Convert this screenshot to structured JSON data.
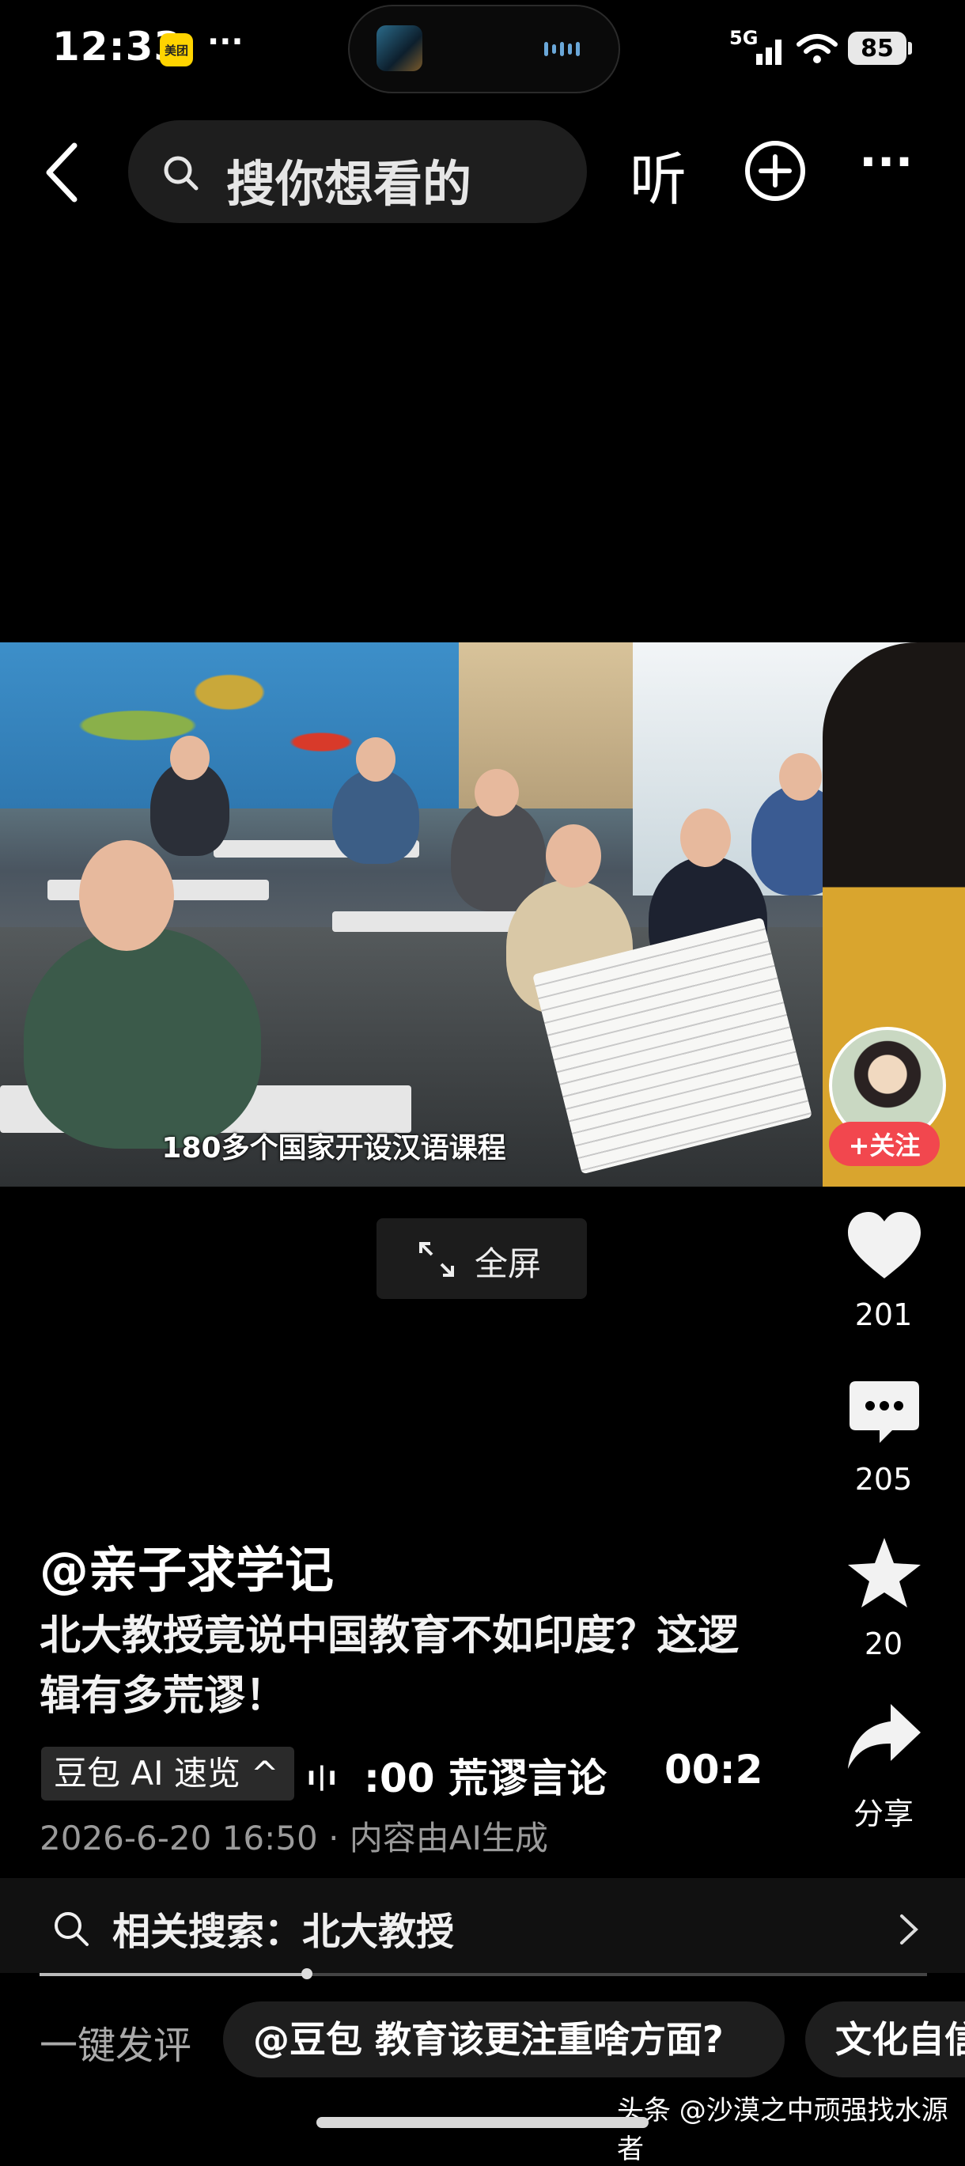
{
  "status_bar": {
    "time": "12:33",
    "app_icon_label": "美团",
    "more_dots": "···",
    "network": "5G",
    "battery": "85"
  },
  "top_nav": {
    "search_placeholder": "搜你想看的",
    "listen_label": "听",
    "more_label": "···"
  },
  "video": {
    "subtitle": "180多个国家开设汉语课程",
    "fullscreen_label": "全屏"
  },
  "author_card": {
    "follow_label": "+关注"
  },
  "actions": {
    "likes": "201",
    "comments": "205",
    "favorites": "20",
    "share_label": "分享"
  },
  "post": {
    "author": "@亲子求学记",
    "title": "北大教授竟说中国教育不如印度？这逻辑有多荒谬！",
    "ai_chip_label": "豆包 AI 速览 ^",
    "ai_segment_1": ":00 荒谬言论",
    "ai_segment_2": "00:2",
    "timestamp": "2026-6-20 16:50 · 内容由AI生成"
  },
  "related_search": {
    "text": "相关搜索：北大教授"
  },
  "playback": {
    "progress": 0.3
  },
  "comment_bar": {
    "quick_label": "一键发评",
    "suggestions": [
      "@豆包 教育该更注重啥方面?",
      "文化自信"
    ]
  },
  "watermark": "头条 @沙漠之中顽强找水源者",
  "colors": {
    "follow_red": "#f2474e",
    "background": "#000000"
  }
}
